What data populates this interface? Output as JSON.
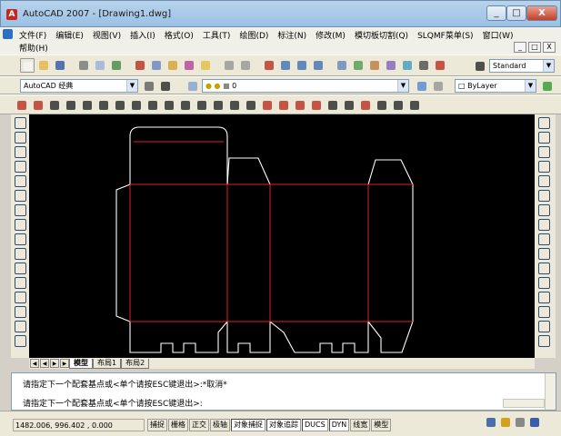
{
  "window": {
    "title": "AutoCAD 2007 - [Drawing1.dwg]",
    "minimize": "_",
    "maximize": "□",
    "close": "X"
  },
  "menu": {
    "row1": [
      "文件(F)",
      "编辑(E)",
      "视图(V)",
      "插入(I)",
      "格式(O)",
      "工具(T)",
      "绘图(D)",
      "标注(N)",
      "修改(M)",
      "模切板切割(Q)",
      "SLQMF菜单(S)",
      "窗口(W)"
    ],
    "row2": [
      "帮助(H)"
    ],
    "mdi": [
      "_",
      "□",
      "X"
    ]
  },
  "toolbar_styles": {
    "text_style": "Standard"
  },
  "workspace": {
    "name": "AutoCAD 经典"
  },
  "layers": {
    "current": "0",
    "color": "ByLayer"
  },
  "tabs": [
    "模型",
    "布局1",
    "布局2"
  ],
  "command": {
    "line1": "请指定下一个配套基点或<单个请按ESC键退出>:*取消*",
    "line2": "请指定下一个配套基点或<单个请按ESC键退出>:"
  },
  "status": {
    "coords": "1482.006, 996.402 , 0.000",
    "buttons": [
      "捕捉",
      "栅格",
      "正交",
      "极轴",
      "对象捕捉",
      "对象追踪",
      "DUCS",
      "DYN",
      "线宽",
      "模型"
    ]
  },
  "colors": {
    "outline": "#ffffff",
    "fold": "#e0202a",
    "background": "#000000"
  }
}
